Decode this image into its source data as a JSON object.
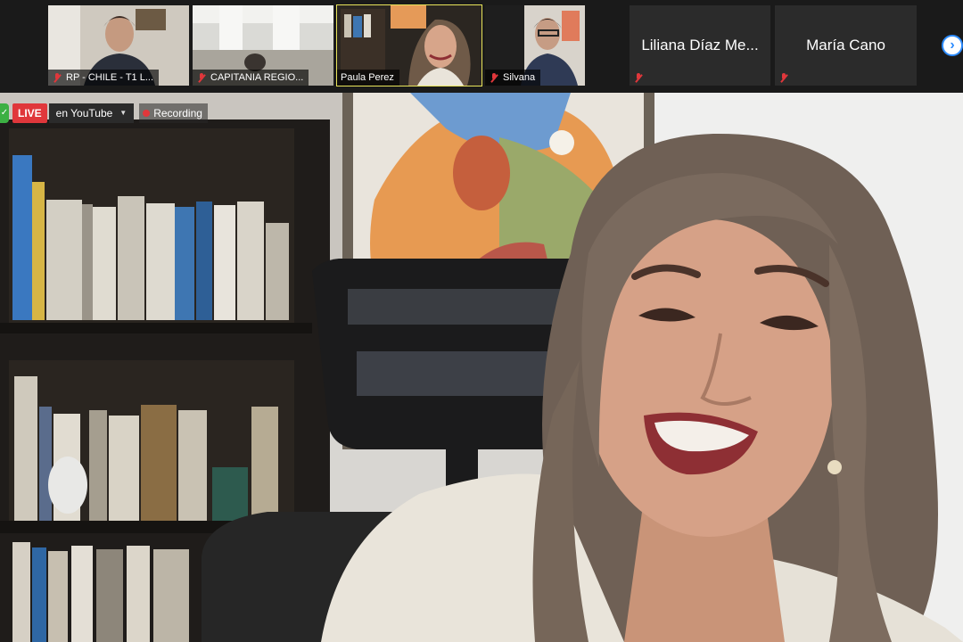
{
  "participants": [
    {
      "name": "RP - CHILE - T1 L...",
      "muted": true,
      "video": true
    },
    {
      "name": "CAPITANIA REGIO...",
      "muted": true,
      "video": true
    },
    {
      "name": "Paula Perez",
      "muted": false,
      "video": true,
      "active": true
    },
    {
      "name": "Silvana",
      "muted": true,
      "video": true
    },
    {
      "name": "Liliana Díaz Me...",
      "muted": true,
      "video": false
    },
    {
      "name": "María Cano",
      "muted": true,
      "video": false
    }
  ],
  "stream": {
    "live_label": "LIVE",
    "platform_label": "en YouTube",
    "recording_label": "Recording"
  },
  "icons": {
    "next_page": "chevron-right-icon",
    "mute": "mic-muted-icon",
    "security": "shield-icon"
  },
  "colors": {
    "live": "#e0373b",
    "active_speaker": "#e8e45a",
    "accent": "#2d8cff",
    "muted": "#e0373b"
  }
}
